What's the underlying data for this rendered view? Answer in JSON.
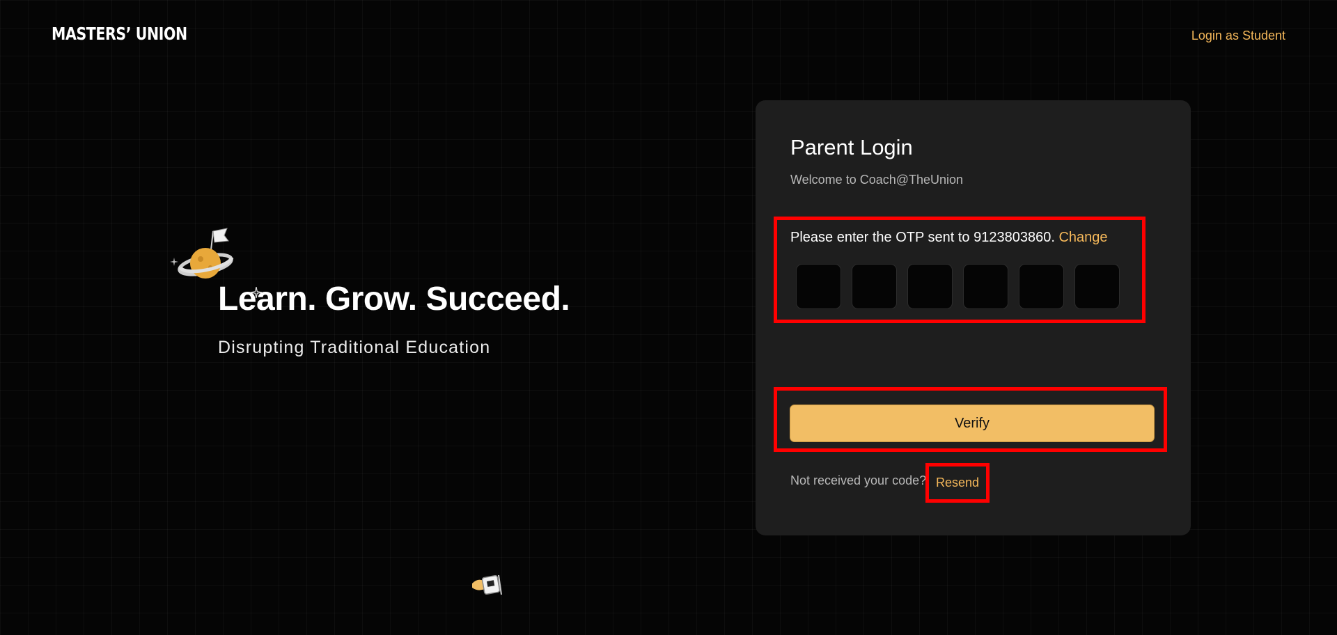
{
  "header": {
    "logo_text": "MASTERS’ UNION",
    "student_login_label": "Login as Student"
  },
  "hero": {
    "title": "Learn. Grow. Succeed.",
    "subtitle": "Disrupting Traditional Education"
  },
  "login_card": {
    "title": "Parent Login",
    "welcome": "Welcome to Coach@TheUnion",
    "otp_prompt": "Please enter the OTP sent to 9123803860.",
    "change_label": "Change",
    "otp_digits": [
      "",
      "",
      "",
      "",
      "",
      ""
    ],
    "verify_label": "Verify",
    "not_received_text": "Not received your code?",
    "resend_label": "Resend"
  },
  "colors": {
    "background": "#050505",
    "card": "#1e1e1e",
    "accent": "#f5b85a",
    "button": "#f2be65",
    "highlight": "#ff0000"
  },
  "icons": {
    "planet": "planet-with-flag-icon",
    "sparkle": "sparkle-icon",
    "bottom_decoration": "gift-flag-icon"
  }
}
